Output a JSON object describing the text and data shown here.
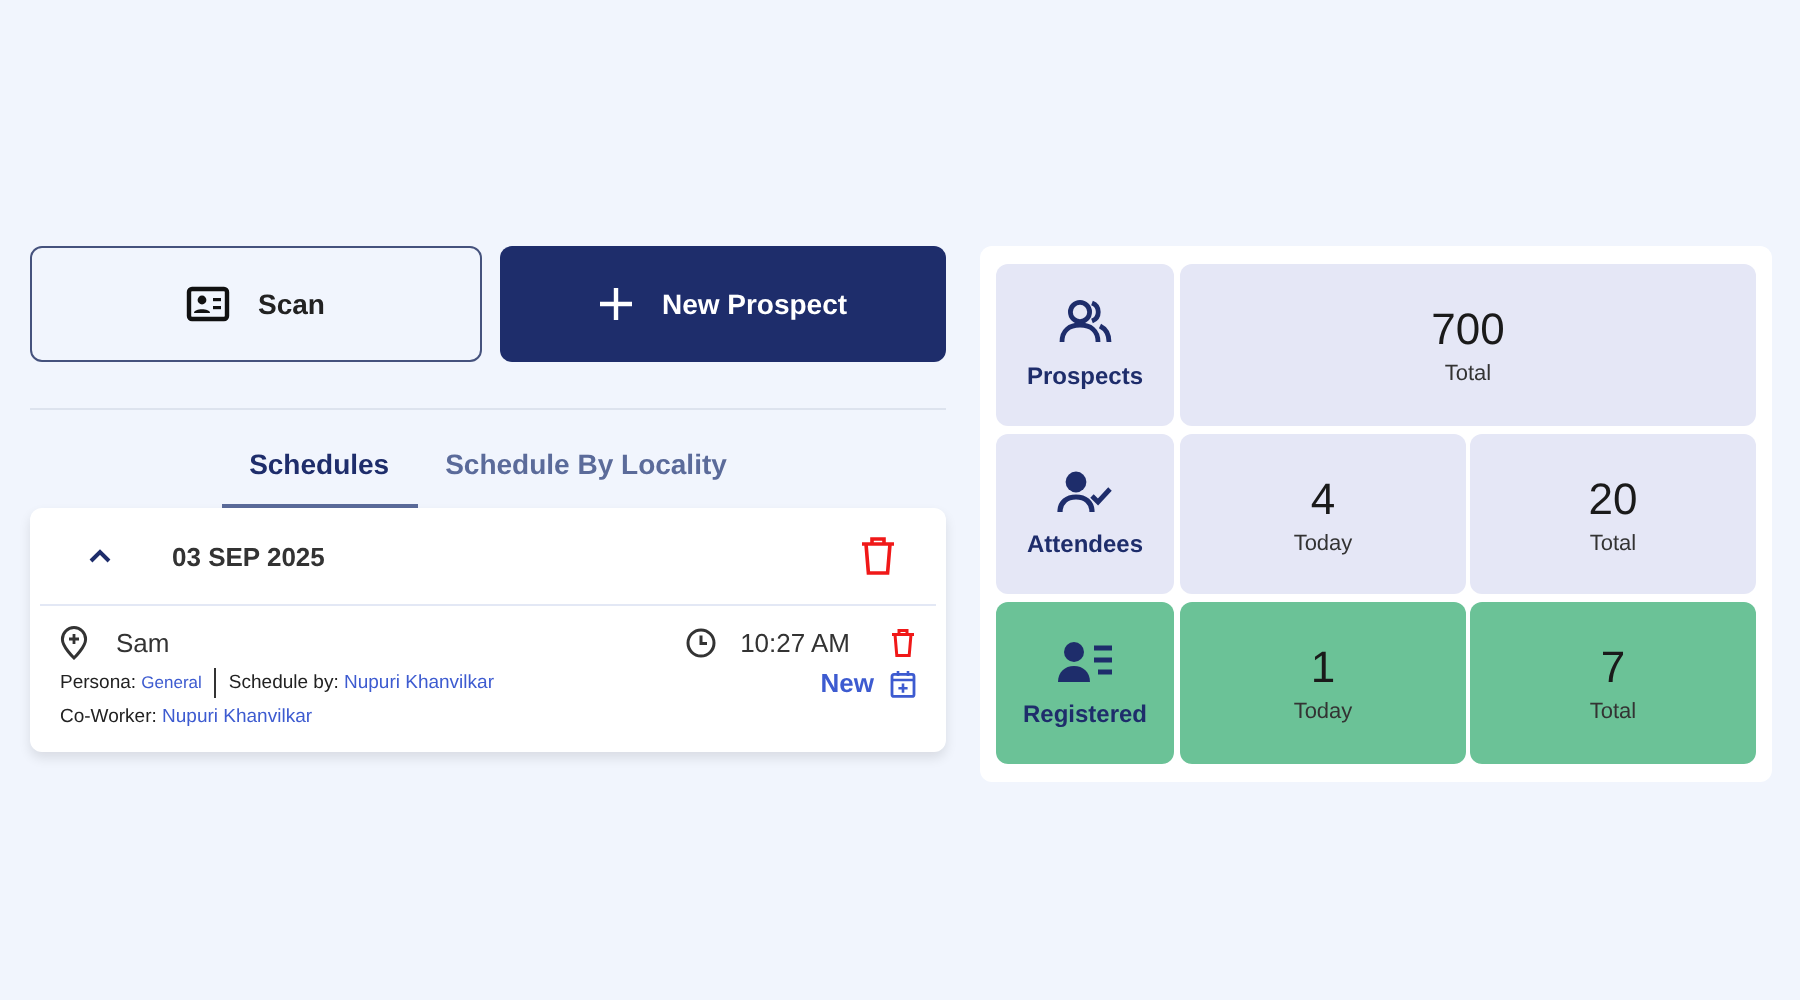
{
  "actions": [
    {
      "kind": "outline",
      "label": "Scan"
    },
    {
      "kind": "filled",
      "label": "New Prospect"
    }
  ],
  "tabs": [
    {
      "label": "Schedules",
      "selected": true
    },
    {
      "label": "Schedule By Locality",
      "selected": false
    }
  ],
  "schedule_groups": [
    {
      "date": "03 SEP 2025",
      "expanded": true,
      "items": [
        {
          "name": "Sam",
          "time": "10:27 AM",
          "persona_label": "Persona:",
          "persona": "General",
          "scheduled_by_label": "Schedule by:",
          "scheduled_by": "Nupuri Khanvilkar",
          "coworker_label": "Co-Worker:",
          "coworker": "Nupuri Khanvilkar",
          "status": "New"
        }
      ]
    }
  ],
  "stats": [
    {
      "kind": "prospects",
      "label": "Prospects",
      "color": "#e5e7f6",
      "cells": [
        {
          "value": "700",
          "label": "Total"
        }
      ]
    },
    {
      "kind": "attendees",
      "label": "Attendees",
      "color": "#e5e7f6",
      "cells": [
        {
          "value": "4",
          "label": "Today"
        },
        {
          "value": "20",
          "label": "Total"
        }
      ]
    },
    {
      "kind": "registered",
      "label": "Registered",
      "color": "#6bc297",
      "cells": [
        {
          "value": "1",
          "label": "Today"
        },
        {
          "value": "7",
          "label": "Total"
        }
      ]
    }
  ]
}
